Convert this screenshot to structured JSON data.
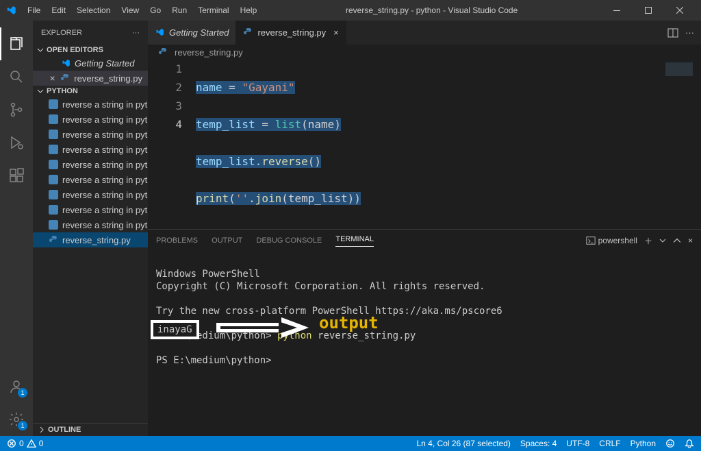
{
  "titlebar": {
    "title": "reverse_string.py - python - Visual Studio Code",
    "menu": [
      "File",
      "Edit",
      "Selection",
      "View",
      "Go",
      "Run",
      "Terminal",
      "Help"
    ]
  },
  "activity": {
    "account_badge": "1",
    "settings_badge": "1"
  },
  "sidebar": {
    "title": "EXPLORER",
    "open_editors": "OPEN EDITORS",
    "open_items": [
      {
        "editor": "getting",
        "label": "Getting Started"
      },
      {
        "editor": "file",
        "label": "reverse_string.py"
      }
    ],
    "workspace": "PYTHON",
    "files": [
      "reverse a string in pyt...",
      "reverse a string in pyt...",
      "reverse a string in pyt...",
      "reverse a string in pyt...",
      "reverse a string in pyt...",
      "reverse a string in pyt...",
      "reverse a string in pyt...",
      "reverse a string in pyt...",
      "reverse a string in pyt...",
      "reverse_string.py"
    ],
    "outline": "OUTLINE"
  },
  "tabs": [
    {
      "kind": "getting",
      "label": "Getting Started",
      "active": false
    },
    {
      "kind": "file",
      "label": "reverse_string.py",
      "active": true
    }
  ],
  "breadcrumb": "reverse_string.py",
  "code": {
    "lines": [
      "1",
      "2",
      "3",
      "4"
    ],
    "l1_a": "name",
    "l1_b": " = ",
    "l1_c": "\"Gayani\"",
    "l2_a": "temp_list",
    "l2_b": " = ",
    "l2_c": "list",
    "l2_d": "(name)",
    "l3_a": "temp_list.",
    "l3_b": "reverse",
    "l3_c": "()",
    "l4_a": "print",
    "l4_b": "(",
    "l4_c": "''",
    "l4_d": ".join",
    "l4_e": "(temp_list))"
  },
  "panel": {
    "tabs": [
      "PROBLEMS",
      "OUTPUT",
      "DEBUG CONSOLE",
      "TERMINAL"
    ],
    "active": 3,
    "shell_label": "powershell",
    "t1": "Windows PowerShell",
    "t2": "Copyright (C) Microsoft Corporation. All rights reserved.",
    "t3": "Try the new cross-platform PowerShell https://aka.ms/pscore6",
    "prompt1_a": "PS E:\\medium\\python> ",
    "prompt1_b": "python",
    "prompt1_c": " reverse_string.py",
    "output": "inayaG",
    "prompt2_a": "PS E:\\medi",
    "prompt2_b": "um\\python> ",
    "annotation": "output"
  },
  "status": {
    "errors": "0",
    "warnings": "0",
    "position": "Ln 4, Col 26 (87 selected)",
    "spaces": "Spaces: 4",
    "encoding": "UTF-8",
    "eol": "CRLF",
    "lang": "Python"
  }
}
